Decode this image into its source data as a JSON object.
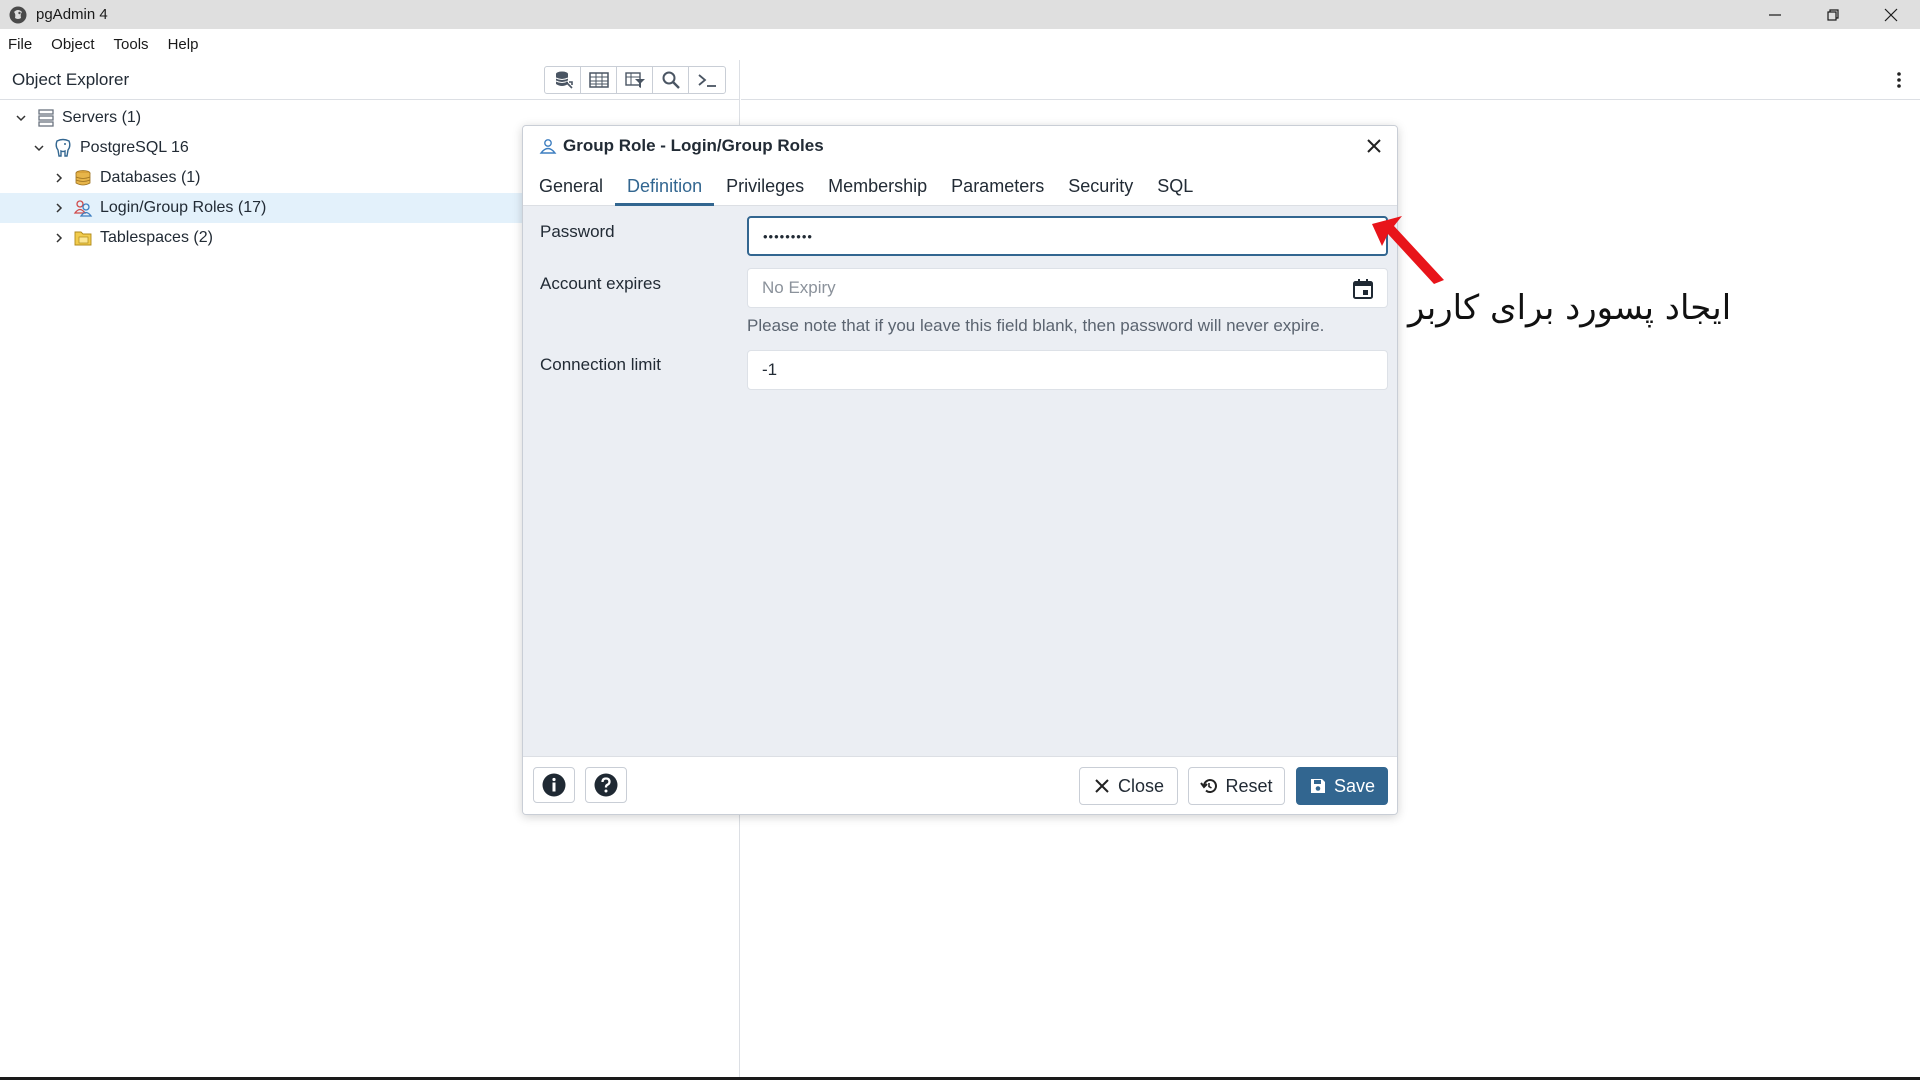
{
  "window": {
    "title": "pgAdmin 4"
  },
  "menu": [
    "File",
    "Object",
    "Tools",
    "Help"
  ],
  "object_explorer": {
    "title": "Object Explorer",
    "toolbar_icons": [
      "query-tool-icon",
      "table-view-icon",
      "filtered-rows-icon",
      "search-objects-icon",
      "psql-tool-icon"
    ],
    "tree": [
      {
        "label": "Servers (1)",
        "level": 0,
        "expanded": true,
        "icon": "servers-icon"
      },
      {
        "label": "PostgreSQL 16",
        "level": 1,
        "expanded": true,
        "icon": "postgres-elephant-icon"
      },
      {
        "label": "Databases (1)",
        "level": 2,
        "expanded": false,
        "icon": "databases-icon"
      },
      {
        "label": "Login/Group Roles (17)",
        "level": 2,
        "expanded": false,
        "icon": "roles-icon",
        "selected": true
      },
      {
        "label": "Tablespaces (2)",
        "level": 2,
        "expanded": false,
        "icon": "tablespaces-icon"
      }
    ]
  },
  "dialog": {
    "title": "Group Role - Login/Group Roles",
    "tabs": [
      "General",
      "Definition",
      "Privileges",
      "Membership",
      "Parameters",
      "Security",
      "SQL"
    ],
    "active_tab": "Definition",
    "fields": {
      "password": {
        "label": "Password",
        "value": "•••••••••"
      },
      "account_expires": {
        "label": "Account expires",
        "placeholder": "No Expiry"
      },
      "help_text": "Please note that if you leave this field blank, then password will never expire.",
      "connection_limit": {
        "label": "Connection limit",
        "value": "-1"
      }
    },
    "footer": {
      "close_label": "Close",
      "reset_label": "Reset",
      "save_label": "Save"
    }
  },
  "annotation": {
    "text": "ایجاد پسورد برای کاربر",
    "color": "#e8141a"
  },
  "colors": {
    "accent": "#326690",
    "selected_row": "#e3f1fb",
    "dialog_bg": "#ebeef3"
  }
}
